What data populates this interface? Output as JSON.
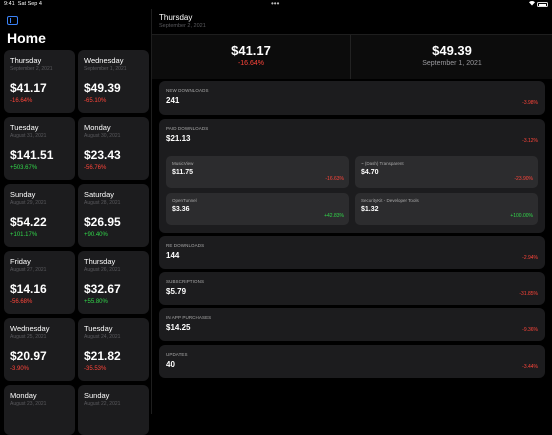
{
  "status_bar": {
    "time": "9:41",
    "date": "Sat Sep 4",
    "dots": "•••",
    "wifi": "wifi-icon",
    "battery": "battery-icon"
  },
  "sidebar": {
    "title": "Home",
    "days": [
      {
        "day": "Thursday",
        "date": "September 2, 2021",
        "amount": "$41.17",
        "change": "-16.64%",
        "trend": "neg"
      },
      {
        "day": "Wednesday",
        "date": "September 1, 2021",
        "amount": "$49.39",
        "change": "-65.10%",
        "trend": "neg"
      },
      {
        "day": "Tuesday",
        "date": "August 31, 2021",
        "amount": "$141.51",
        "change": "+503.67%",
        "trend": "pos"
      },
      {
        "day": "Monday",
        "date": "August 30, 2021",
        "amount": "$23.43",
        "change": "-56.76%",
        "trend": "neg"
      },
      {
        "day": "Sunday",
        "date": "August 29, 2021",
        "amount": "$54.22",
        "change": "+101.17%",
        "trend": "pos"
      },
      {
        "day": "Saturday",
        "date": "August 28, 2021",
        "amount": "$26.95",
        "change": "+90.40%",
        "trend": "pos"
      },
      {
        "day": "Friday",
        "date": "August 27, 2021",
        "amount": "$14.16",
        "change": "-56.68%",
        "trend": "neg"
      },
      {
        "day": "Thursday",
        "date": "August 26, 2021",
        "amount": "$32.67",
        "change": "+55.80%",
        "trend": "pos"
      },
      {
        "day": "Wednesday",
        "date": "August 25, 2021",
        "amount": "$20.97",
        "change": "-3.90%",
        "trend": "neg"
      },
      {
        "day": "Tuesday",
        "date": "August 24, 2021",
        "amount": "$21.82",
        "change": "-35.53%",
        "trend": "neg"
      },
      {
        "day": "Monday",
        "date": "August 23, 2021",
        "amount": "",
        "change": "",
        "trend": "neg"
      },
      {
        "day": "Sunday",
        "date": "August 22, 2021",
        "amount": "",
        "change": "",
        "trend": "neg"
      }
    ]
  },
  "main": {
    "day": "Thursday",
    "date": "September 2, 2021",
    "total": {
      "amount": "$41.17",
      "change": "-16.64%"
    },
    "previous": {
      "amount": "$49.39",
      "date": "September 1, 2021"
    },
    "sections": [
      {
        "label": "NEW DOWNLOADS",
        "value": "241",
        "change": "-3.98%"
      },
      {
        "label": "PAID DOWNLOADS",
        "value": "$21.13",
        "change": "-3.12%"
      },
      {
        "label": "RE DOWNLOADS",
        "value": "144",
        "change": "-2.94%"
      },
      {
        "label": "SUBSCRIPTIONS",
        "value": "$5.79",
        "change": "-31.85%"
      },
      {
        "label": "IN APP PURCHASES",
        "value": "$14.25",
        "change": "-9.36%"
      },
      {
        "label": "UPDATES",
        "value": "40",
        "change": "-3.44%"
      }
    ],
    "apps": [
      {
        "name": "MusicView",
        "value": "$11.75",
        "change": "-16.63%",
        "trend": "neg"
      },
      {
        "name": "~ (Dash) Transparent",
        "value": "$4.70",
        "change": "-23.90%",
        "trend": "neg"
      },
      {
        "name": "OpenTunnel",
        "value": "$3.36",
        "change": "+42.83%",
        "trend": "pos"
      },
      {
        "name": "SecurityKit - Developer Tools",
        "value": "$1.32",
        "change": "+100.00%",
        "trend": "pos"
      }
    ]
  },
  "colors": {
    "negative": "#ff453a",
    "positive": "#32d74b",
    "accent": "#3b82f6"
  }
}
